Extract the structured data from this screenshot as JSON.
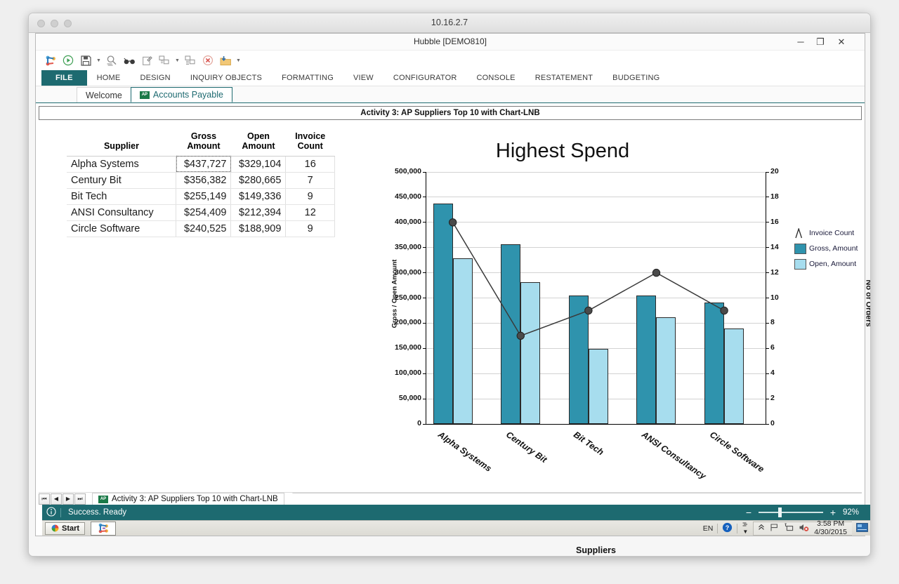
{
  "mac": {
    "host": "10.16.2.7"
  },
  "app": {
    "title": "Hubble [DEMO810]",
    "minimize": "─",
    "maximize": "❐",
    "close": "✕"
  },
  "quick_access": {
    "icons": [
      "hubble-logo-icon",
      "run-icon",
      "save-icon",
      "save-dropdown-caret",
      "find-icon",
      "glasses-icon",
      "edit-icon",
      "refresh-icon",
      "refresh-dropdown-caret",
      "refresh-all-icon",
      "cancel-icon",
      "export-icon",
      "qat-overflow-caret"
    ]
  },
  "ribbon": {
    "tabs": [
      "FILE",
      "HOME",
      "DESIGN",
      "INQUIRY OBJECTS",
      "FORMATTING",
      "VIEW",
      "CONFIGURATOR",
      "CONSOLE",
      "RESTATEMENT",
      "BUDGETING"
    ]
  },
  "doc_tabs": [
    {
      "label": "Welcome",
      "badge": "",
      "active": false
    },
    {
      "label": "Accounts Payable",
      "badge": "AP",
      "active": true
    }
  ],
  "activity": {
    "title": "Activity 3: AP Suppliers Top 10 with Chart-LNB"
  },
  "grid": {
    "columns": [
      "Supplier",
      "Gross\nAmount",
      "Open\nAmount",
      "Invoice\nCount"
    ],
    "columns_flat": [
      "Supplier",
      "Gross Amount",
      "Open Amount",
      "Invoice Count"
    ],
    "rows": [
      {
        "supplier": "Alpha Systems",
        "gross": "$437,727",
        "open": "$329,104",
        "count": "16"
      },
      {
        "supplier": "Century Bit",
        "gross": "$356,382",
        "open": "$280,665",
        "count": "7"
      },
      {
        "supplier": "Bit Tech",
        "gross": "$255,149",
        "open": "$149,336",
        "count": "9"
      },
      {
        "supplier": "ANSI Consultancy",
        "gross": "$254,409",
        "open": "$212,394",
        "count": "12"
      },
      {
        "supplier": "Circle Software",
        "gross": "$240,525",
        "open": "$188,909",
        "count": "9"
      }
    ]
  },
  "chart_data": {
    "type": "bar",
    "title": "Highest Spend",
    "xlabel": "Suppliers",
    "ylabel": "Gross / Open Amount",
    "y2label": "No of Orders",
    "categories": [
      "Alpha Systems",
      "Century Bit",
      "Bit Tech",
      "ANSI Consultancy",
      "Circle Software"
    ],
    "series": [
      {
        "name": "Gross, Amount",
        "kind": "bar",
        "axis": "left",
        "color": "#2f93ad",
        "values": [
          437727,
          356382,
          255149,
          254409,
          240525
        ]
      },
      {
        "name": "Open, Amount",
        "kind": "bar",
        "axis": "left",
        "color": "#a7ddee",
        "values": [
          329104,
          280665,
          149336,
          212394,
          188909
        ]
      },
      {
        "name": "Invoice Count",
        "kind": "line",
        "axis": "right",
        "color": "#3a3a3a",
        "values": [
          16,
          7,
          9,
          12,
          9
        ]
      }
    ],
    "ylim": [
      0,
      500000
    ],
    "ytick_step": 50000,
    "yticks": [
      "0",
      "50,000",
      "100,000",
      "150,000",
      "200,000",
      "250,000",
      "300,000",
      "350,000",
      "400,000",
      "450,000",
      "500,000"
    ],
    "y2lim": [
      0,
      20
    ],
    "y2tick_step": 2,
    "y2ticks": [
      "0",
      "2",
      "4",
      "6",
      "8",
      "10",
      "12",
      "14",
      "16",
      "18",
      "20"
    ],
    "grid": true,
    "legend_position": "right-top",
    "xtick_rotation": -35
  },
  "record_nav": {
    "buttons": [
      "⏮",
      "◀",
      "▶",
      "⏭"
    ],
    "tab_label": "Activity 3: AP Suppliers Top 10 with Chart-LNB",
    "tab_badge": "AP"
  },
  "status": {
    "info_icon": "info-icon",
    "message": "Success. Ready",
    "zoom_minus": "−",
    "zoom_plus": "+",
    "zoom_value": "92%"
  },
  "taskbar": {
    "start_label": "Start",
    "app_icon": "hubble-taskbar-icon",
    "language": "EN",
    "help_icon": "help-icon",
    "show_hidden_icon": "show-hidden-icons-chevron",
    "tray_icons": [
      "action-center-flag-icon",
      "network-icon",
      "volume-muted-icon"
    ],
    "time": "3:58 PM",
    "date": "4/30/2015"
  },
  "colors": {
    "accent": "#1d6a70",
    "gross": "#2f93ad",
    "open": "#a7ddee",
    "line": "#3a3a3a"
  }
}
